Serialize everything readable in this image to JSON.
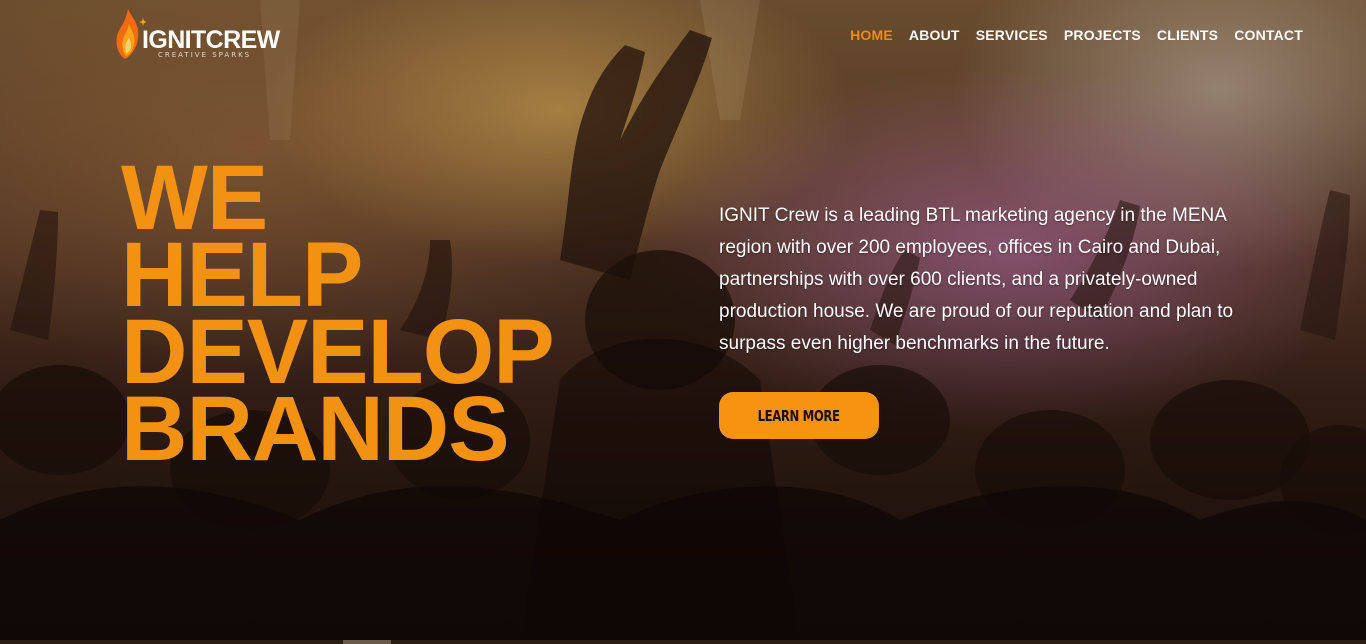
{
  "header": {
    "logo": {
      "wordmark": "IGNITCREW",
      "tagline": "CREATIVE SPARKS"
    },
    "nav": [
      {
        "label": "HOME",
        "active": true
      },
      {
        "label": "ABOUT",
        "active": false
      },
      {
        "label": "SERVICES",
        "active": false
      },
      {
        "label": "PROJECTS",
        "active": false
      },
      {
        "label": "CLIENTS",
        "active": false
      },
      {
        "label": "CONTACT",
        "active": false
      }
    ]
  },
  "hero": {
    "headline": [
      "WE",
      "HELP",
      "DEVELOP",
      "BRANDS"
    ],
    "intro": "IGNIT Crew is a leading BTL marketing agency in the MENA region with over 200 employees, offices in Cairo and Dubai, partnerships with over 600 clients, and a privately-owned production house. We are proud of our reputation and plan to surpass even higher benchmarks in the future.",
    "cta_label": "LEARN MORE"
  },
  "colors": {
    "accent": "#f39212",
    "nav_active": "#f08a12",
    "text": "#ffffff",
    "button_bg": "#f7930f",
    "button_text": "#1a1008"
  },
  "icons": {
    "logo_mark": "flame-icon"
  }
}
